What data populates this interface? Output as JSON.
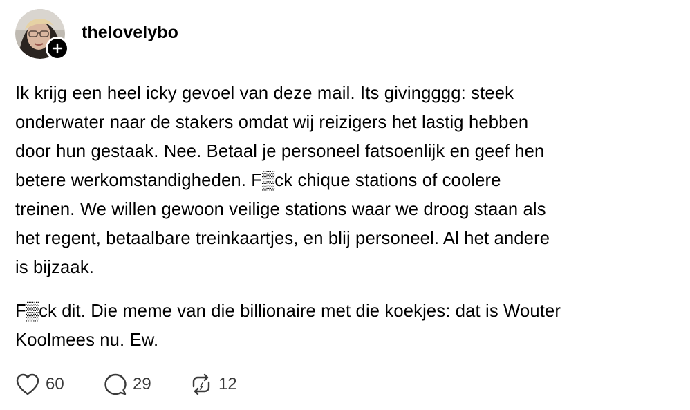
{
  "post": {
    "author": {
      "username": "thelovelybo",
      "avatar_icon": "avatar-photo"
    },
    "paragraphs": [
      "Ik krijg een heel icky gevoel van deze mail. Its givingggg: steek\nonderwater naar de stakers omdat wij reizigers het lastig hebben\ndoor hun gestaak. Nee. Betaal je personeel fatsoenlijk en geef hen\nbetere werkomstandigheden. F▒ck chique stations of coolere\ntreinen. We willen gewoon veilige stations waar we droog staan als\nhet regent, betaalbare treinkaartjes, en blij personeel. Al het andere\nis bijzaak.",
      "F▒ck dit. Die meme van die billionaire met die koekjes: dat is Wouter\nKoolmees nu. Ew."
    ],
    "actions": {
      "likes": "60",
      "replies": "29",
      "reposts": "12"
    }
  },
  "icons": {
    "follow": "plus-icon",
    "like": "heart-icon",
    "reply": "speech-bubble-icon",
    "repost": "repost-arrows-icon"
  },
  "colors": {
    "text": "#000000",
    "muted": "#3a3a3a",
    "background": "#ffffff"
  }
}
